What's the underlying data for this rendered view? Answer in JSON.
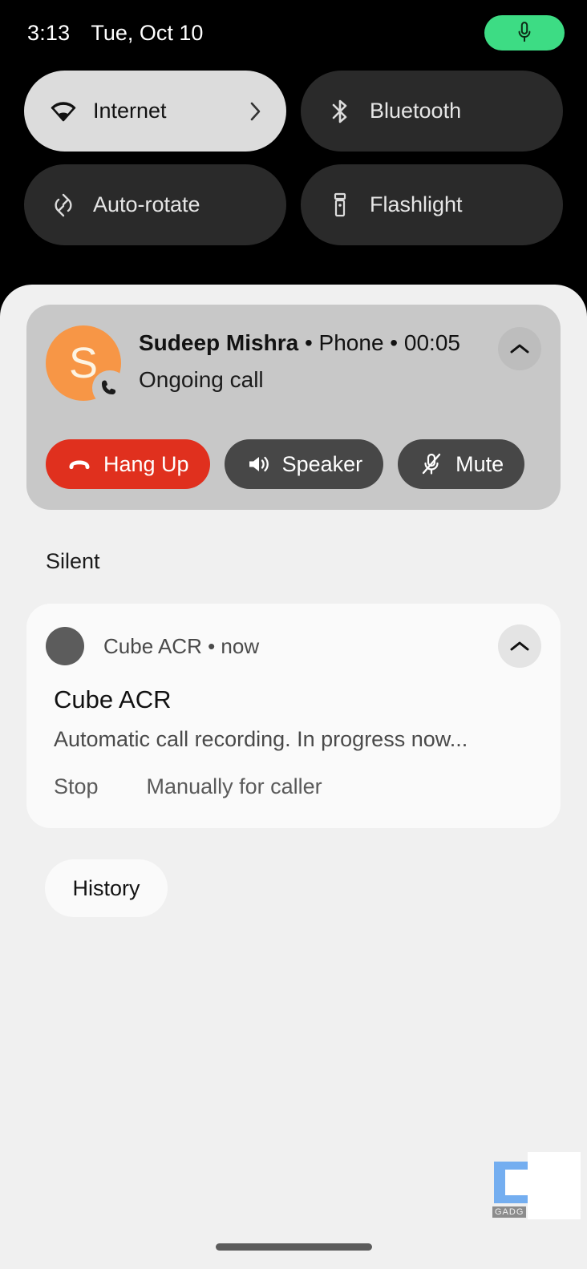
{
  "status_bar": {
    "time": "3:13",
    "date": "Tue, Oct 10",
    "mic_indicator": {
      "icon": "microphone-icon",
      "color": "#3ddc84"
    }
  },
  "quick_settings": {
    "tiles": [
      {
        "label": "Internet",
        "icon": "wifi-icon",
        "state": "active",
        "has_chevron": true,
        "chevron_icon": "chevron-right-icon"
      },
      {
        "label": "Bluetooth",
        "icon": "bluetooth-icon",
        "state": "inactive",
        "has_chevron": false
      },
      {
        "label": "Auto-rotate",
        "icon": "auto-rotate-icon",
        "state": "inactive",
        "has_chevron": false
      },
      {
        "label": "Flashlight",
        "icon": "flashlight-icon",
        "state": "inactive",
        "has_chevron": false
      }
    ]
  },
  "notifications": {
    "call": {
      "avatar_letter": "S",
      "avatar_color": "#f79646",
      "badge_icon": "phone-icon",
      "contact_name": "Sudeep Mishra",
      "separator_1": " • ",
      "app": "Phone",
      "separator_2": " • ",
      "duration": "00:05",
      "status": "Ongoing call",
      "collapse_icon": "chevron-up-icon",
      "actions": [
        {
          "label": "Hang Up",
          "icon": "phone-hangup-icon",
          "color": "#e0301e"
        },
        {
          "label": "Speaker",
          "icon": "speaker-icon",
          "color": "#474747"
        },
        {
          "label": "Mute",
          "icon": "mic-off-icon",
          "color": "#474747"
        }
      ]
    },
    "silent_section_label": "Silent",
    "cube_acr": {
      "app_name": "Cube ACR",
      "separator": " • ",
      "time": "now",
      "title": "Cube ACR",
      "body": "Automatic call recording. In progress now...",
      "collapse_icon": "chevron-up-icon",
      "actions": [
        {
          "label": "Stop"
        },
        {
          "label": "Manually for caller"
        }
      ]
    },
    "history_button": "History"
  },
  "watermark": {
    "text": "GADG"
  }
}
